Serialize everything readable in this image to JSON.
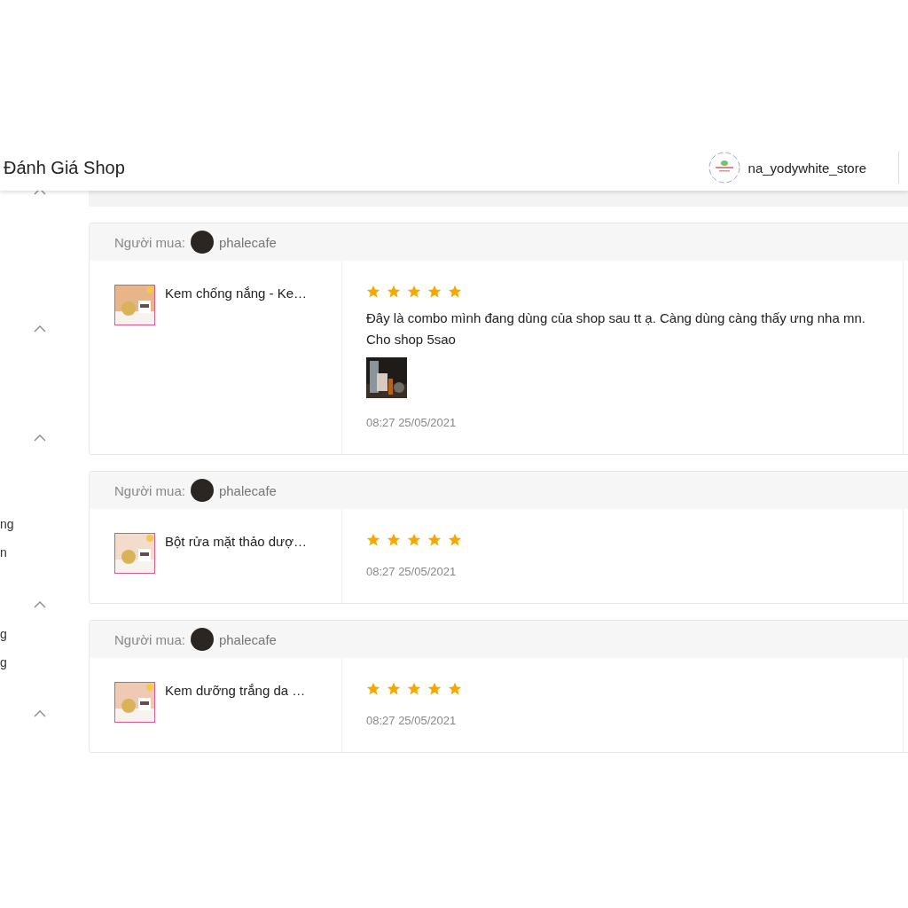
{
  "header": {
    "title": "Đánh Giá Shop",
    "store_name": "na_yodywhite_store"
  },
  "sidebar": {
    "items": [
      {
        "kind": "toggle"
      },
      {
        "kind": "toggle"
      },
      {
        "kind": "toggle"
      },
      {
        "kind": "text",
        "label": "ng"
      },
      {
        "kind": "text",
        "label": "n"
      },
      {
        "kind": "toggle"
      },
      {
        "kind": "text",
        "label": "g"
      },
      {
        "kind": "text",
        "label": "g"
      },
      {
        "kind": "toggle"
      }
    ]
  },
  "reviews": [
    {
      "buyer_label": "Người mua:",
      "buyer": "phalecafe",
      "product": "Kem chống nắng - Ke…",
      "stars": 5,
      "comment": "Đây là combo mình đang dùng của shop sau tt ạ. Càng dùng càng thấy ưng nha mn. Cho shop 5sao",
      "photos": [
        {
          "kind": "picture"
        }
      ],
      "time": "08:27 25/05/2021"
    },
    {
      "buyer_label": "Người mua:",
      "buyer": "phalecafe",
      "product": "Bột rửa mặt thảo dượ…",
      "stars": 5,
      "time": "08:27 25/05/2021"
    },
    {
      "buyer_label": "Người mua:",
      "buyer": "phalecafe",
      "product": "Kem dưỡng trắng da …",
      "stars": 5,
      "time": "08:27 25/05/2021"
    }
  ]
}
